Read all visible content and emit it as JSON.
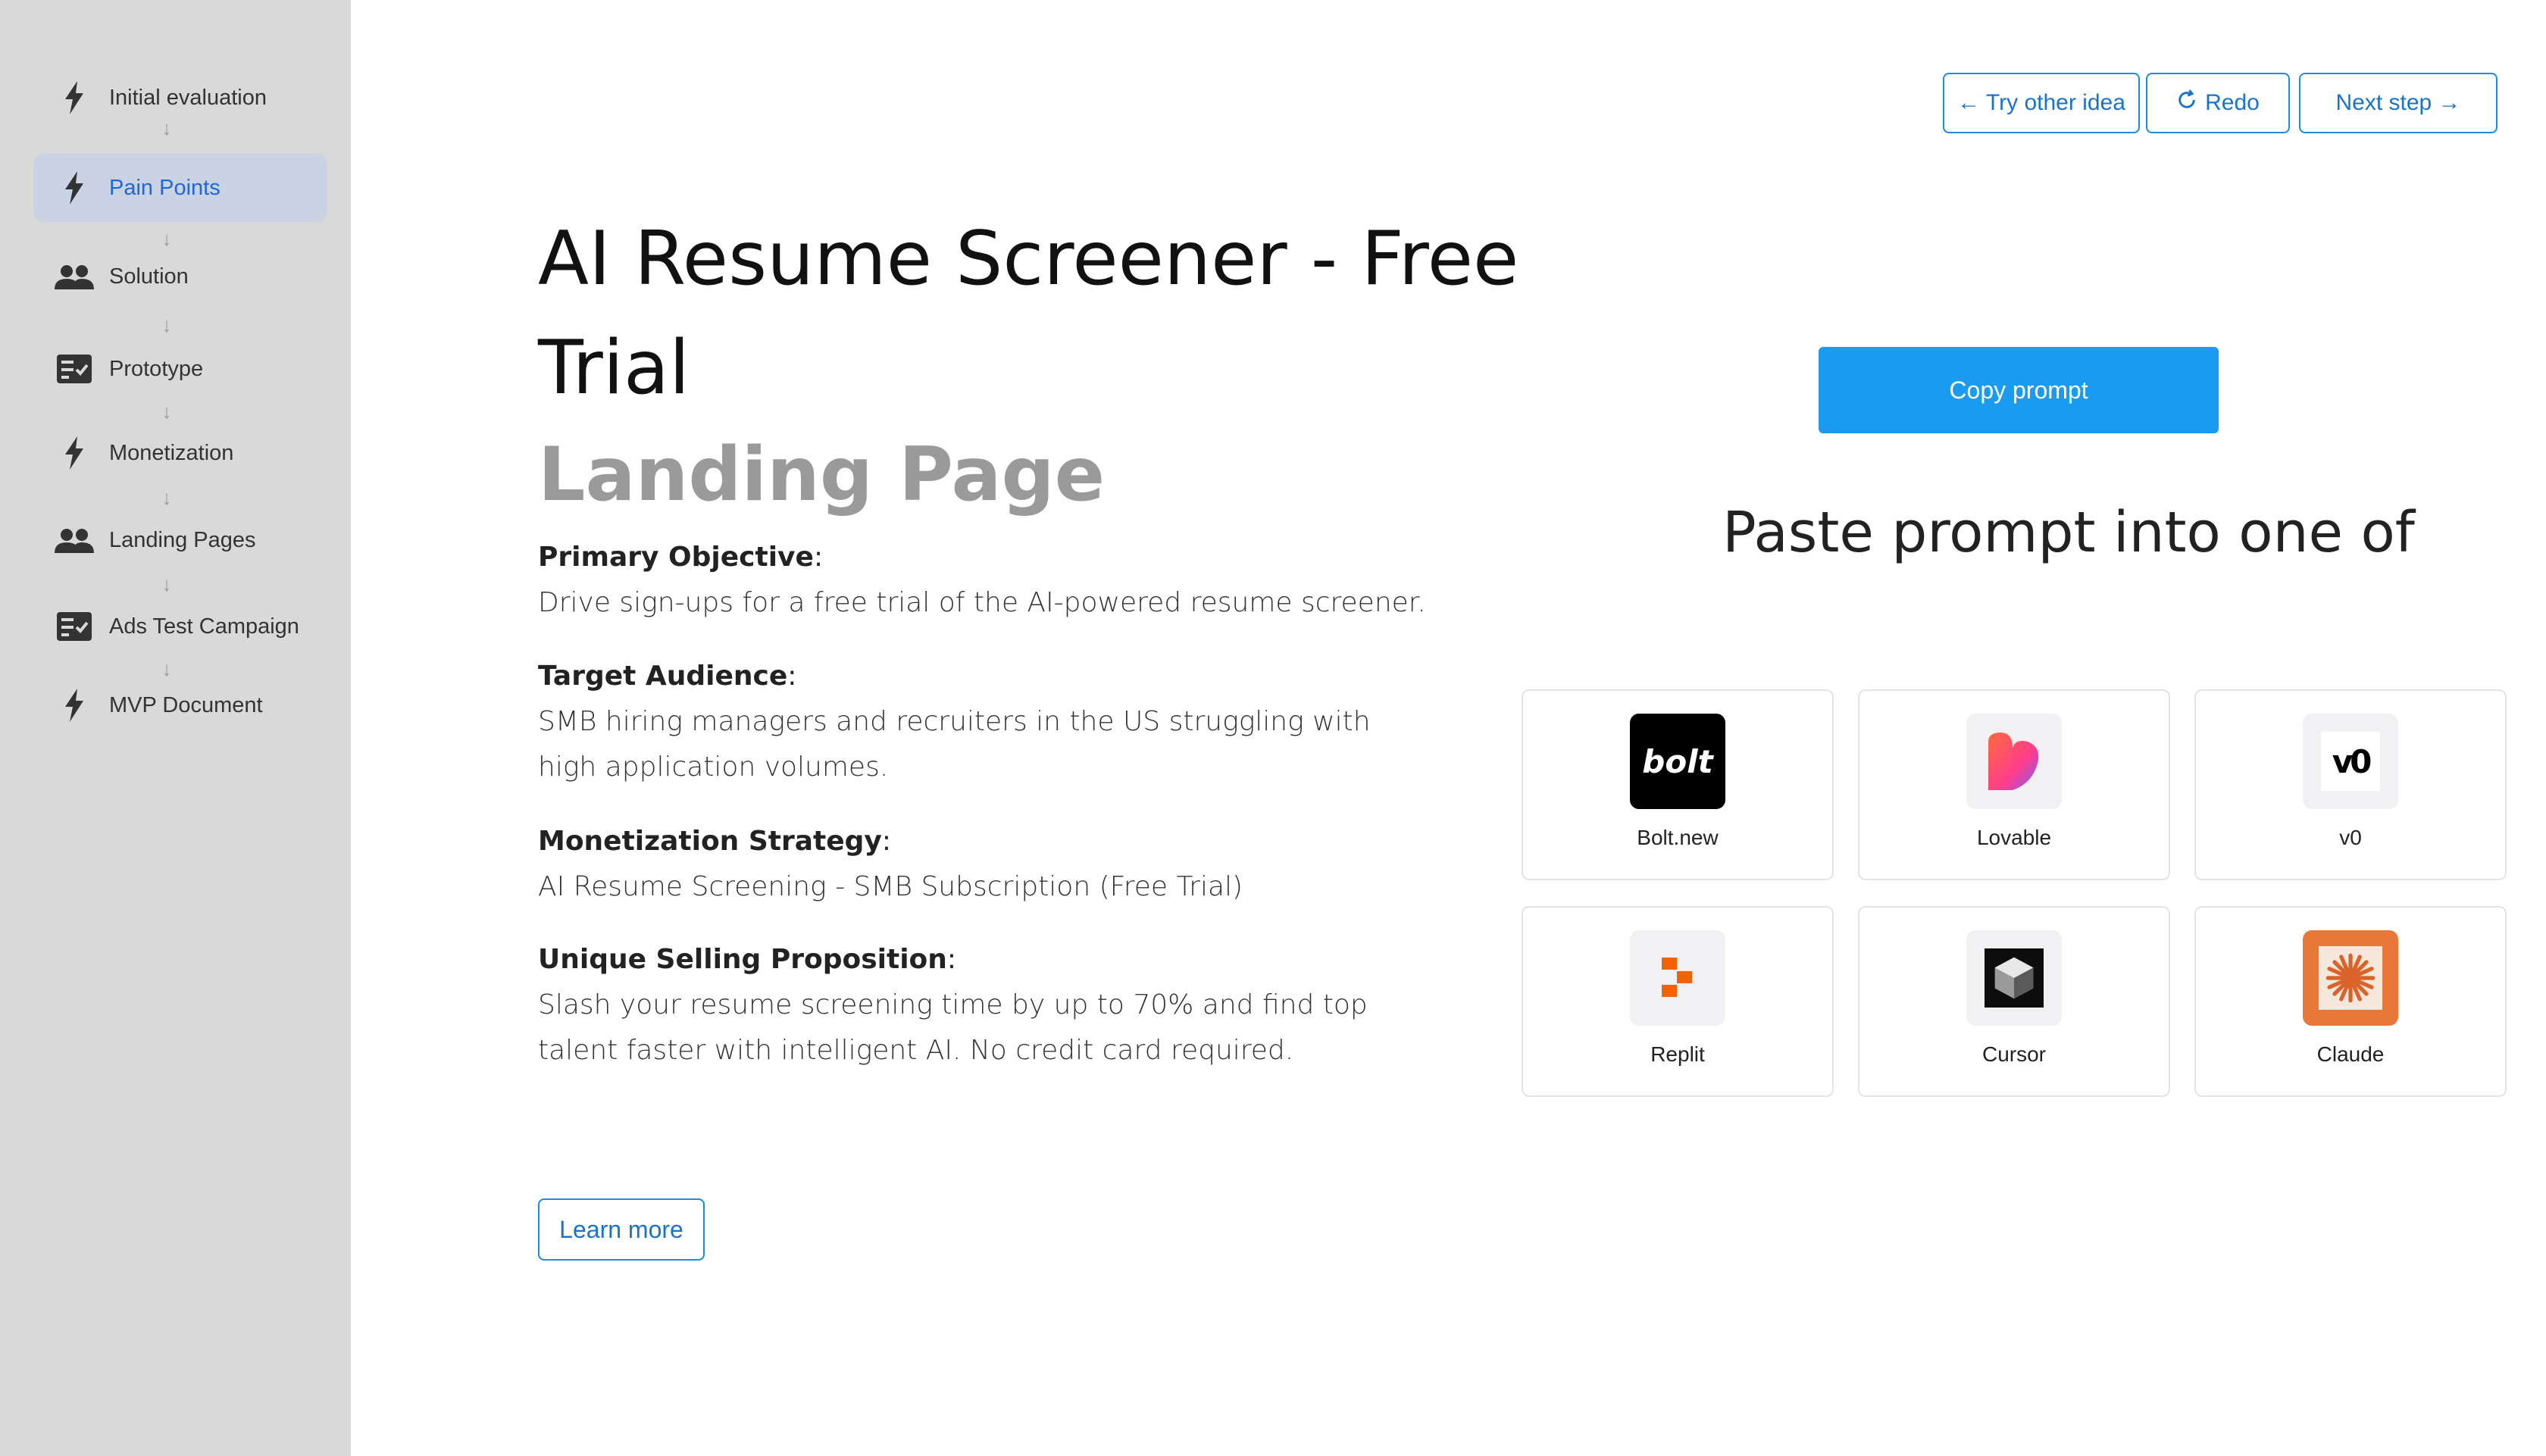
{
  "sidebar": {
    "items": [
      {
        "label": "Initial evaluation",
        "icon": "bolt-icon",
        "active": false
      },
      {
        "label": "Pain Points",
        "icon": "bolt-icon",
        "active": true
      },
      {
        "label": "Solution",
        "icon": "people-icon",
        "active": false
      },
      {
        "label": "Prototype",
        "icon": "checklist-icon",
        "active": false
      },
      {
        "label": "Monetization",
        "icon": "bolt-icon",
        "active": false
      },
      {
        "label": "Landing Pages",
        "icon": "people-icon",
        "active": false
      },
      {
        "label": "Ads Test Campaign",
        "icon": "checklist-icon",
        "active": false
      },
      {
        "label": "MVP Document",
        "icon": "bolt-icon",
        "active": false
      }
    ],
    "arrow": "↓"
  },
  "toolbar": {
    "try_other_idea": "← Try other idea",
    "redo": "Redo",
    "next_step": "Next step →"
  },
  "main": {
    "title": "AI Resume Screener - Free Trial",
    "subtitle": "Landing Page",
    "sections": [
      {
        "heading": "Primary Objective",
        "body": "Drive sign-ups for a free trial of the AI-powered resume screener."
      },
      {
        "heading": "Target Audience",
        "body": "SMB hiring managers and recruiters in the US struggling with high application volumes."
      },
      {
        "heading": "Monetization Strategy",
        "body": "AI Resume Screening - SMB Subscription (Free Trial)"
      },
      {
        "heading": "Unique Selling Proposition",
        "body": "Slash your resume screening time by up to 70% and find top talent faster with intelligent AI. No credit card required."
      }
    ],
    "colon": ":",
    "learn_more": "Learn more"
  },
  "prompt_panel": {
    "copy_prompt": "Copy prompt",
    "paste_heading": "Paste prompt into one of",
    "tools": [
      {
        "name": "Bolt.new",
        "logo_text": "bolt",
        "bg": "#000000"
      },
      {
        "name": "Lovable",
        "logo_text": "",
        "bg": "#f1f1f3"
      },
      {
        "name": "v0",
        "logo_text": "v0",
        "bg": "#f1f1f3"
      },
      {
        "name": "Replit",
        "logo_text": "",
        "bg": "#f1f1f3"
      },
      {
        "name": "Cursor",
        "logo_text": "",
        "bg": "#f1f1f3"
      },
      {
        "name": "Claude",
        "logo_text": "",
        "bg": "#e8783a"
      }
    ]
  },
  "colors": {
    "accent": "#1a8de0",
    "primary_button": "#1a9bf0",
    "sidebar_bg": "#d9d9d9",
    "active_nav_bg": "#c9d3e3",
    "active_nav_text": "#2166d8"
  }
}
